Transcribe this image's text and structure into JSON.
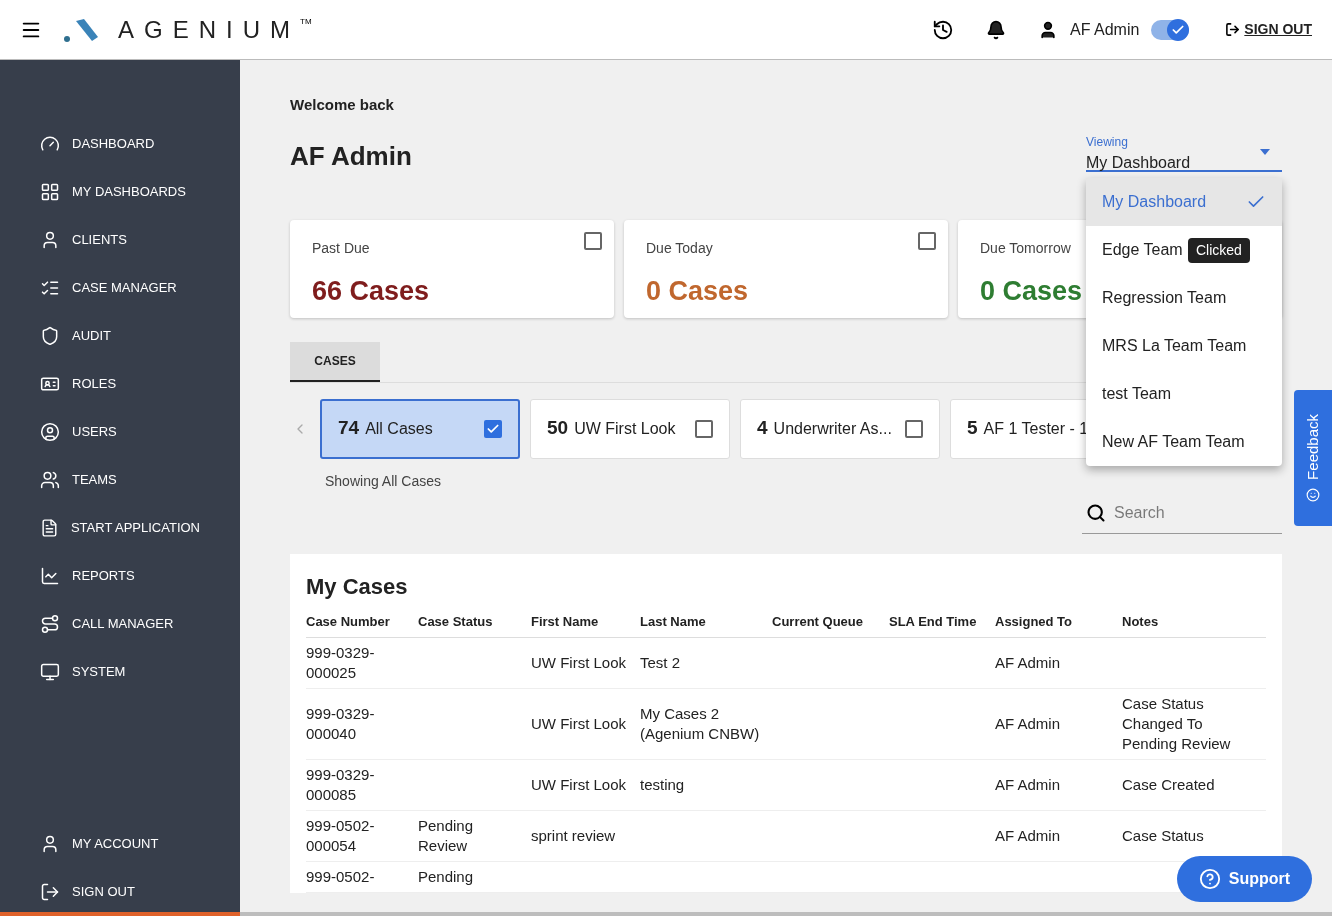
{
  "header": {
    "brand": "AGENIUM",
    "trademark": "TM",
    "user": "AF Admin",
    "toggle_on": true,
    "sign_out": "SIGN OUT"
  },
  "sidebar": {
    "items": [
      {
        "kind": "dashboard",
        "label": "DASHBOARD"
      },
      {
        "kind": "grid",
        "label": "MY DASHBOARDS"
      },
      {
        "kind": "person",
        "label": "CLIENTS"
      },
      {
        "kind": "checklist",
        "label": "CASE MANAGER"
      },
      {
        "kind": "shield",
        "label": "AUDIT"
      },
      {
        "kind": "card",
        "label": "ROLES"
      },
      {
        "kind": "user-circle",
        "label": "USERS"
      },
      {
        "kind": "group",
        "label": "TEAMS"
      },
      {
        "kind": "file",
        "label": "START APPLICATION"
      },
      {
        "kind": "chart",
        "label": "REPORTS"
      },
      {
        "kind": "route",
        "label": "CALL MANAGER"
      },
      {
        "kind": "monitor",
        "label": "SYSTEM"
      }
    ],
    "bottom_items": [
      {
        "kind": "person",
        "label": "MY ACCOUNT"
      },
      {
        "kind": "logout",
        "label": "SIGN OUT"
      }
    ]
  },
  "welcome": "Welcome back",
  "user_name": "AF Admin",
  "viewing": {
    "label": "Viewing",
    "value": "My Dashboard",
    "options": [
      {
        "label": "My Dashboard",
        "selected": true
      },
      {
        "label": "Edge Team",
        "selected": false
      },
      {
        "label": "Regression Team",
        "selected": false
      },
      {
        "label": "MRS La Team Team",
        "selected": false
      },
      {
        "label": "test Team",
        "selected": false
      },
      {
        "label": "New AF Team Team",
        "selected": false
      }
    ],
    "tooltip": "Clicked"
  },
  "summary_cards": [
    {
      "label": "Past Due",
      "value": "66 Cases",
      "color": "#7f1d1d",
      "checked": false
    },
    {
      "label": "Due Today",
      "value": "0 Cases",
      "color": "#c0672e",
      "checked": false
    },
    {
      "label": "Due Tomorrow",
      "value": "0 Cases",
      "color": "#2e7d32"
    }
  ],
  "tabs": [
    {
      "label": "CASES",
      "selected": true
    }
  ],
  "queue_chips": [
    {
      "count": "74",
      "label": "All Cases",
      "checked": true,
      "selected": true
    },
    {
      "count": "50",
      "label": "UW First Look",
      "checked": false,
      "selected": false
    },
    {
      "count": "4",
      "label": "Underwriter As...",
      "checked": false,
      "selected": false
    },
    {
      "count": "5",
      "label": "AF 1 Tester - 1",
      "selected": false
    }
  ],
  "showing": "Showing All Cases",
  "search": {
    "placeholder": "Search"
  },
  "table": {
    "title": "My Cases",
    "columns": [
      "Case Number",
      "Case Status",
      "First Name",
      "Last Name",
      "Current Queue",
      "SLA End Time",
      "Assigned To",
      "Notes"
    ],
    "rows": [
      [
        "999-0329-000025",
        "",
        "UW First Look",
        "Test 2",
        "",
        "",
        "AF Admin",
        ""
      ],
      [
        "999-0329-000040",
        "",
        "UW First Look",
        "My Cases 2 (Agenium CNBW)",
        "",
        "",
        "AF Admin",
        "Case Status Changed To Pending Review"
      ],
      [
        "999-0329-000085",
        "",
        "UW First Look",
        "testing",
        "",
        "",
        "AF Admin",
        "Case Created"
      ],
      [
        "999-0502-000054",
        "Pending Review",
        "sprint review",
        "",
        "",
        "",
        "AF Admin",
        "Case Status"
      ],
      [
        "999-0502-",
        "Pending",
        "",
        "",
        "",
        "",
        "",
        ""
      ]
    ]
  },
  "feedback": "Feedback",
  "support": "Support",
  "loading_bar": {
    "level": 0.18
  }
}
